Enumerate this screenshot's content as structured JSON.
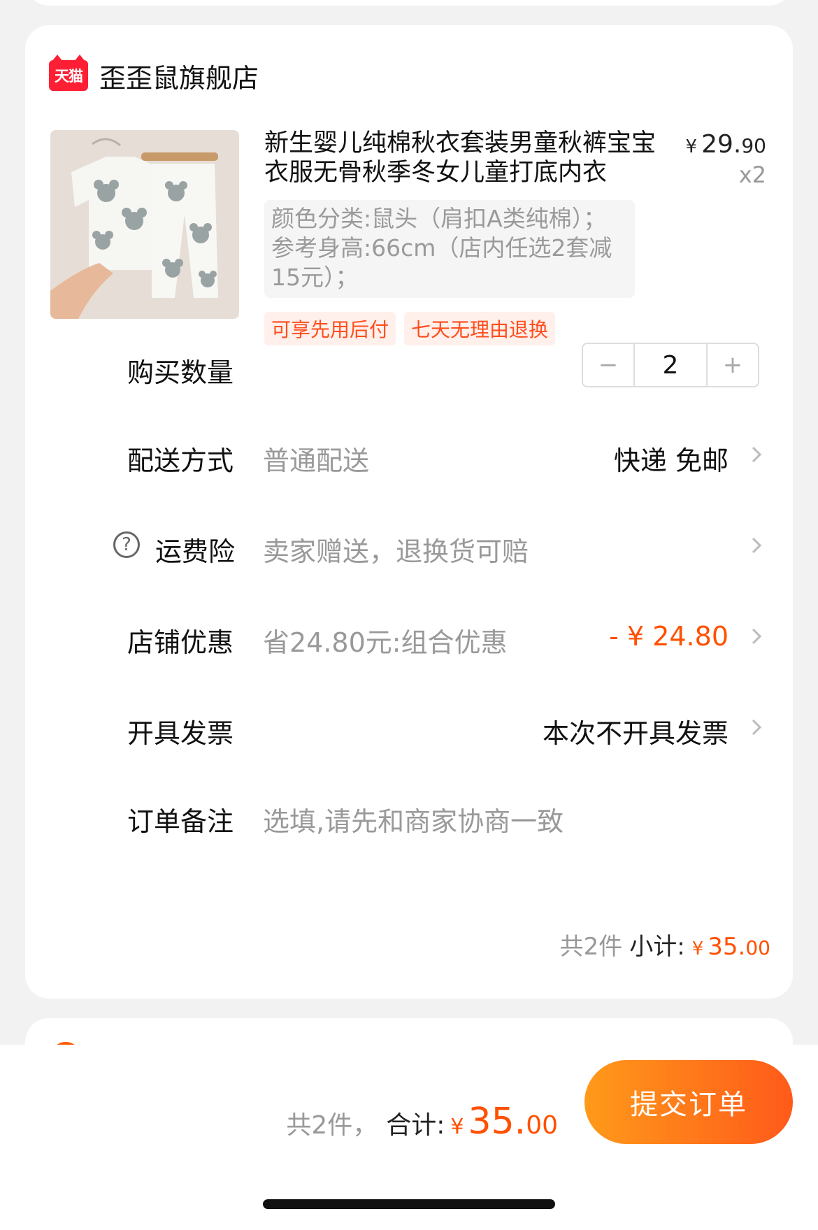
{
  "store": {
    "badge": "天猫",
    "name": "歪歪鼠旗舰店"
  },
  "product": {
    "title": "新生婴儿纯棉秋衣套装男童秋裤宝宝衣服无骨秋季冬女儿童打底内衣",
    "price_symbol": "¥",
    "price_int": "29.",
    "price_dec": "90",
    "quantity_mult": "x2",
    "sku": "颜色分类:鼠头（肩扣A类纯棉）；参考身高:66cm（店内任选2套减15元）；",
    "tags": [
      "可享先用后付",
      "七天无理由退换"
    ]
  },
  "rows": {
    "quantity": {
      "label": "购买数量",
      "minus": "−",
      "value": "2",
      "plus": "+"
    },
    "delivery": {
      "label": "配送方式",
      "sub": "普通配送",
      "value": "快递 免邮"
    },
    "insurance": {
      "icon": "?",
      "label": "运费险",
      "sub": "卖家赠送，退换货可赔"
    },
    "discount": {
      "label": "店铺优惠",
      "sub": "省24.80元:组合优惠",
      "value": "- ¥ 24.80"
    },
    "invoice": {
      "label": "开具发票",
      "value": "本次不开具发票"
    },
    "note": {
      "label": "订单备注",
      "placeholder": "选填,请先和商家协商一致"
    }
  },
  "subtotal": {
    "count_text": "共2件",
    "label": "小计:",
    "symbol": "¥",
    "int": "35.",
    "dec": "00"
  },
  "footer": {
    "count_text": "共2件，",
    "label": "合计:",
    "symbol": "¥",
    "int": "35.",
    "dec": "00",
    "submit": "提交订单"
  },
  "colors": {
    "accent": "#ff5000",
    "tmall_red": "#ff1f34",
    "button_gradient_start": "#ff9a1a",
    "button_gradient_end": "#ff5a1a"
  }
}
